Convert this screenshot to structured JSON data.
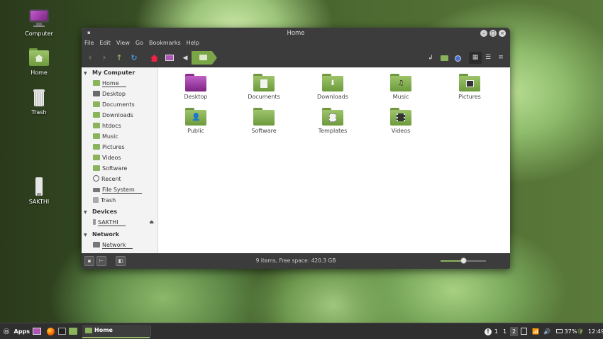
{
  "desktop": {
    "icons": [
      {
        "label": "Computer",
        "icon": "computer-icon"
      },
      {
        "label": "Home",
        "icon": "home-folder-icon"
      },
      {
        "label": "Trash",
        "icon": "trash-icon"
      },
      {
        "label": "SAKTHI",
        "icon": "usb-drive-icon"
      }
    ]
  },
  "window": {
    "title": "Home",
    "menu": [
      "File",
      "Edit",
      "View",
      "Go",
      "Bookmarks",
      "Help"
    ],
    "toolbar": {
      "icons": [
        "back-icon",
        "forward-icon",
        "up-icon",
        "reload-icon",
        "home-icon",
        "computer-icon",
        "breadcrumb-left-icon",
        "terminal-icon",
        "new-folder-icon",
        "search-icon",
        "icon-view-icon",
        "list-view-icon",
        "compact-view-icon"
      ]
    },
    "sidebar": {
      "sections": [
        {
          "title": "My Computer",
          "items": [
            "Home",
            "Desktop",
            "Documents",
            "Downloads",
            "htdocs",
            "Music",
            "Pictures",
            "Videos",
            "Software",
            "Recent",
            "File System",
            "Trash"
          ]
        },
        {
          "title": "Devices",
          "items": [
            "SAKTHI"
          ]
        },
        {
          "title": "Network",
          "items": [
            "Network"
          ]
        }
      ]
    },
    "files": [
      {
        "label": "Desktop",
        "emblem": ""
      },
      {
        "label": "Documents",
        "emblem": "document-icon"
      },
      {
        "label": "Downloads",
        "emblem": "download-icon"
      },
      {
        "label": "Music",
        "emblem": "music-icon"
      },
      {
        "label": "Pictures",
        "emblem": "picture-icon"
      },
      {
        "label": "Public",
        "emblem": "person-icon"
      },
      {
        "label": "Software",
        "emblem": ""
      },
      {
        "label": "Templates",
        "emblem": "template-icon"
      },
      {
        "label": "Videos",
        "emblem": "video-icon"
      }
    ],
    "status": {
      "text": "9 items, Free space: 420.3 GB",
      "zoom_level": 0.5
    }
  },
  "taskbar": {
    "menu_label": "Apps",
    "window_label": "Home",
    "workspaces": [
      "1",
      "2"
    ],
    "battery": "37%",
    "clock": "12:49"
  },
  "colors": {
    "accent": "#8bb35b",
    "titlebar": "#3c3c3c",
    "purple_folder": "#b055b8"
  }
}
